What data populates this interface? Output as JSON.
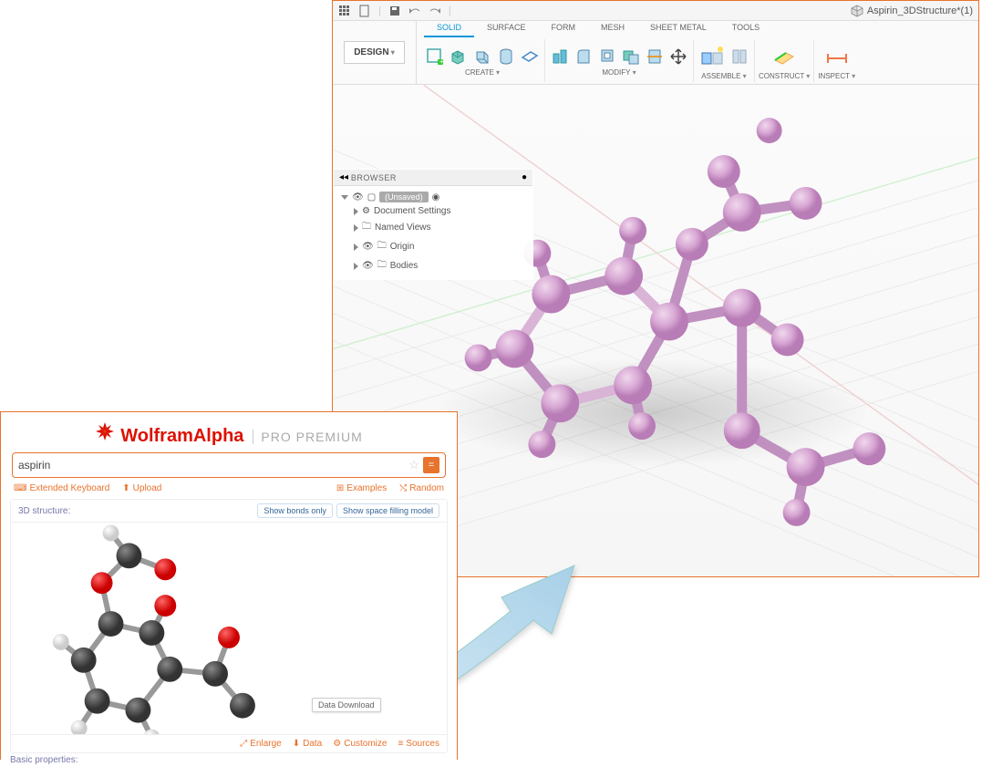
{
  "fusion": {
    "document_title": "Aspirin_3DStructure*(1)",
    "design_button": "DESIGN",
    "tabs": [
      "SOLID",
      "SURFACE",
      "FORM",
      "MESH",
      "SHEET METAL",
      "TOOLS"
    ],
    "active_tab": 0,
    "groups": {
      "create": "CREATE",
      "modify": "MODIFY",
      "assemble": "ASSEMBLE",
      "construct": "CONSTRUCT",
      "inspect": "INSPECT"
    },
    "browser": {
      "title": "BROWSER",
      "root": "(Unsaved)",
      "items": [
        "Document Settings",
        "Named Views",
        "Origin",
        "Bodies"
      ]
    }
  },
  "wolfram": {
    "brand": "WolframAlpha",
    "tier": "PRO PREMIUM",
    "query": "aspirin",
    "links": {
      "ext_keyboard": "Extended Keyboard",
      "upload": "Upload",
      "examples": "Examples",
      "random": "Random"
    },
    "section_title": "3D structure:",
    "buttons": {
      "bonds": "Show bonds only",
      "space": "Show space filling model"
    },
    "tooltip": "Data Download",
    "footer": {
      "enlarge": "Enlarge",
      "data": "Data",
      "customize": "Customize",
      "sources": "Sources"
    },
    "basic": "Basic properties:"
  }
}
